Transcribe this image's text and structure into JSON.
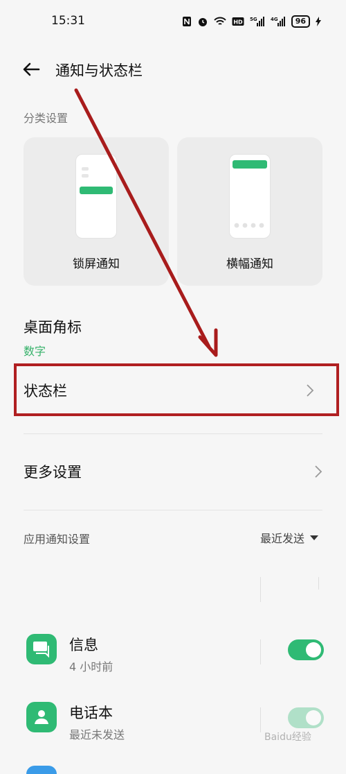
{
  "status_bar": {
    "time": "15:31",
    "icons": [
      "nfc-icon",
      "alarm-icon",
      "wifi-icon",
      "hd-icon",
      "5g-signal-icon",
      "4g-signal-icon"
    ],
    "battery": "96"
  },
  "header": {
    "title": "通知与状态栏"
  },
  "category": {
    "label": "分类设置",
    "cards": [
      {
        "label": "锁屏通知"
      },
      {
        "label": "横幅通知"
      }
    ]
  },
  "desktop_badge": {
    "title": "桌面角标",
    "value": "数字"
  },
  "status_bar_row": {
    "label": "状态栏"
  },
  "more_settings": {
    "label": "更多设置"
  },
  "app_notifications": {
    "label": "应用通知设置",
    "sort": "最近发送",
    "apps": [
      {
        "name": "信息",
        "sub": "4 小时前",
        "enabled": true
      },
      {
        "name": "电话本",
        "sub": "最近未发送",
        "enabled": true
      }
    ]
  },
  "colors": {
    "accent": "#2fba74",
    "highlight_box": "#b01f21",
    "arrow": "#a81c1c"
  },
  "watermark": {
    "text": "Baidu经验"
  }
}
